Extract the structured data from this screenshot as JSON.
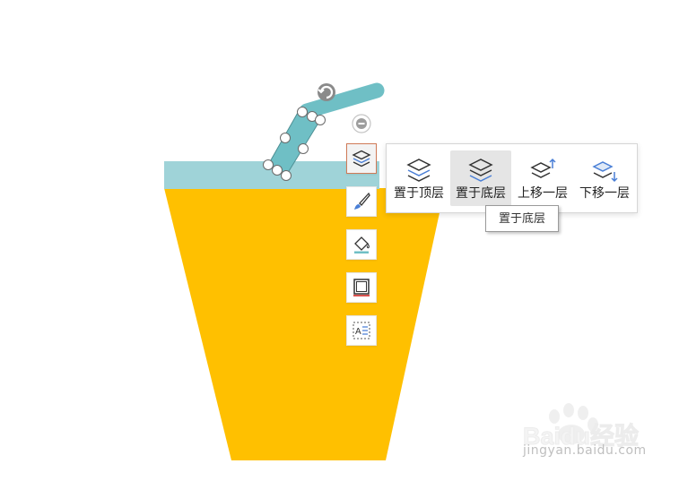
{
  "canvas": {
    "cup_body_color": "#FFC000",
    "cup_rim_color": "#9FD3D8",
    "straw_color": "#6FBFC5"
  },
  "sidebar": {
    "items": [
      {
        "icon": "layers-icon",
        "active": true
      },
      {
        "icon": "brush-icon",
        "active": false
      },
      {
        "icon": "fill-bucket-icon",
        "active": false
      },
      {
        "icon": "outline-icon",
        "active": false
      },
      {
        "icon": "text-wrap-icon",
        "active": false
      }
    ],
    "collapse_icon": "minus-circle-icon"
  },
  "layer_menu": {
    "items": [
      {
        "label": "置于顶层",
        "icon": "bring-to-front-icon"
      },
      {
        "label": "置于底层",
        "icon": "send-to-back-icon",
        "hover": true
      },
      {
        "label": "上移一层",
        "icon": "bring-forward-icon"
      },
      {
        "label": "下移一层",
        "icon": "send-backward-icon"
      }
    ]
  },
  "tooltip": {
    "text": "置于底层"
  },
  "watermark": {
    "logo": "Baidu经验",
    "url": "jingyan.baidu.com"
  },
  "colors": {
    "accent_blue": "#4A7FD6",
    "active_border": "#D07A57",
    "hover_bg": "#E5E5E5"
  }
}
